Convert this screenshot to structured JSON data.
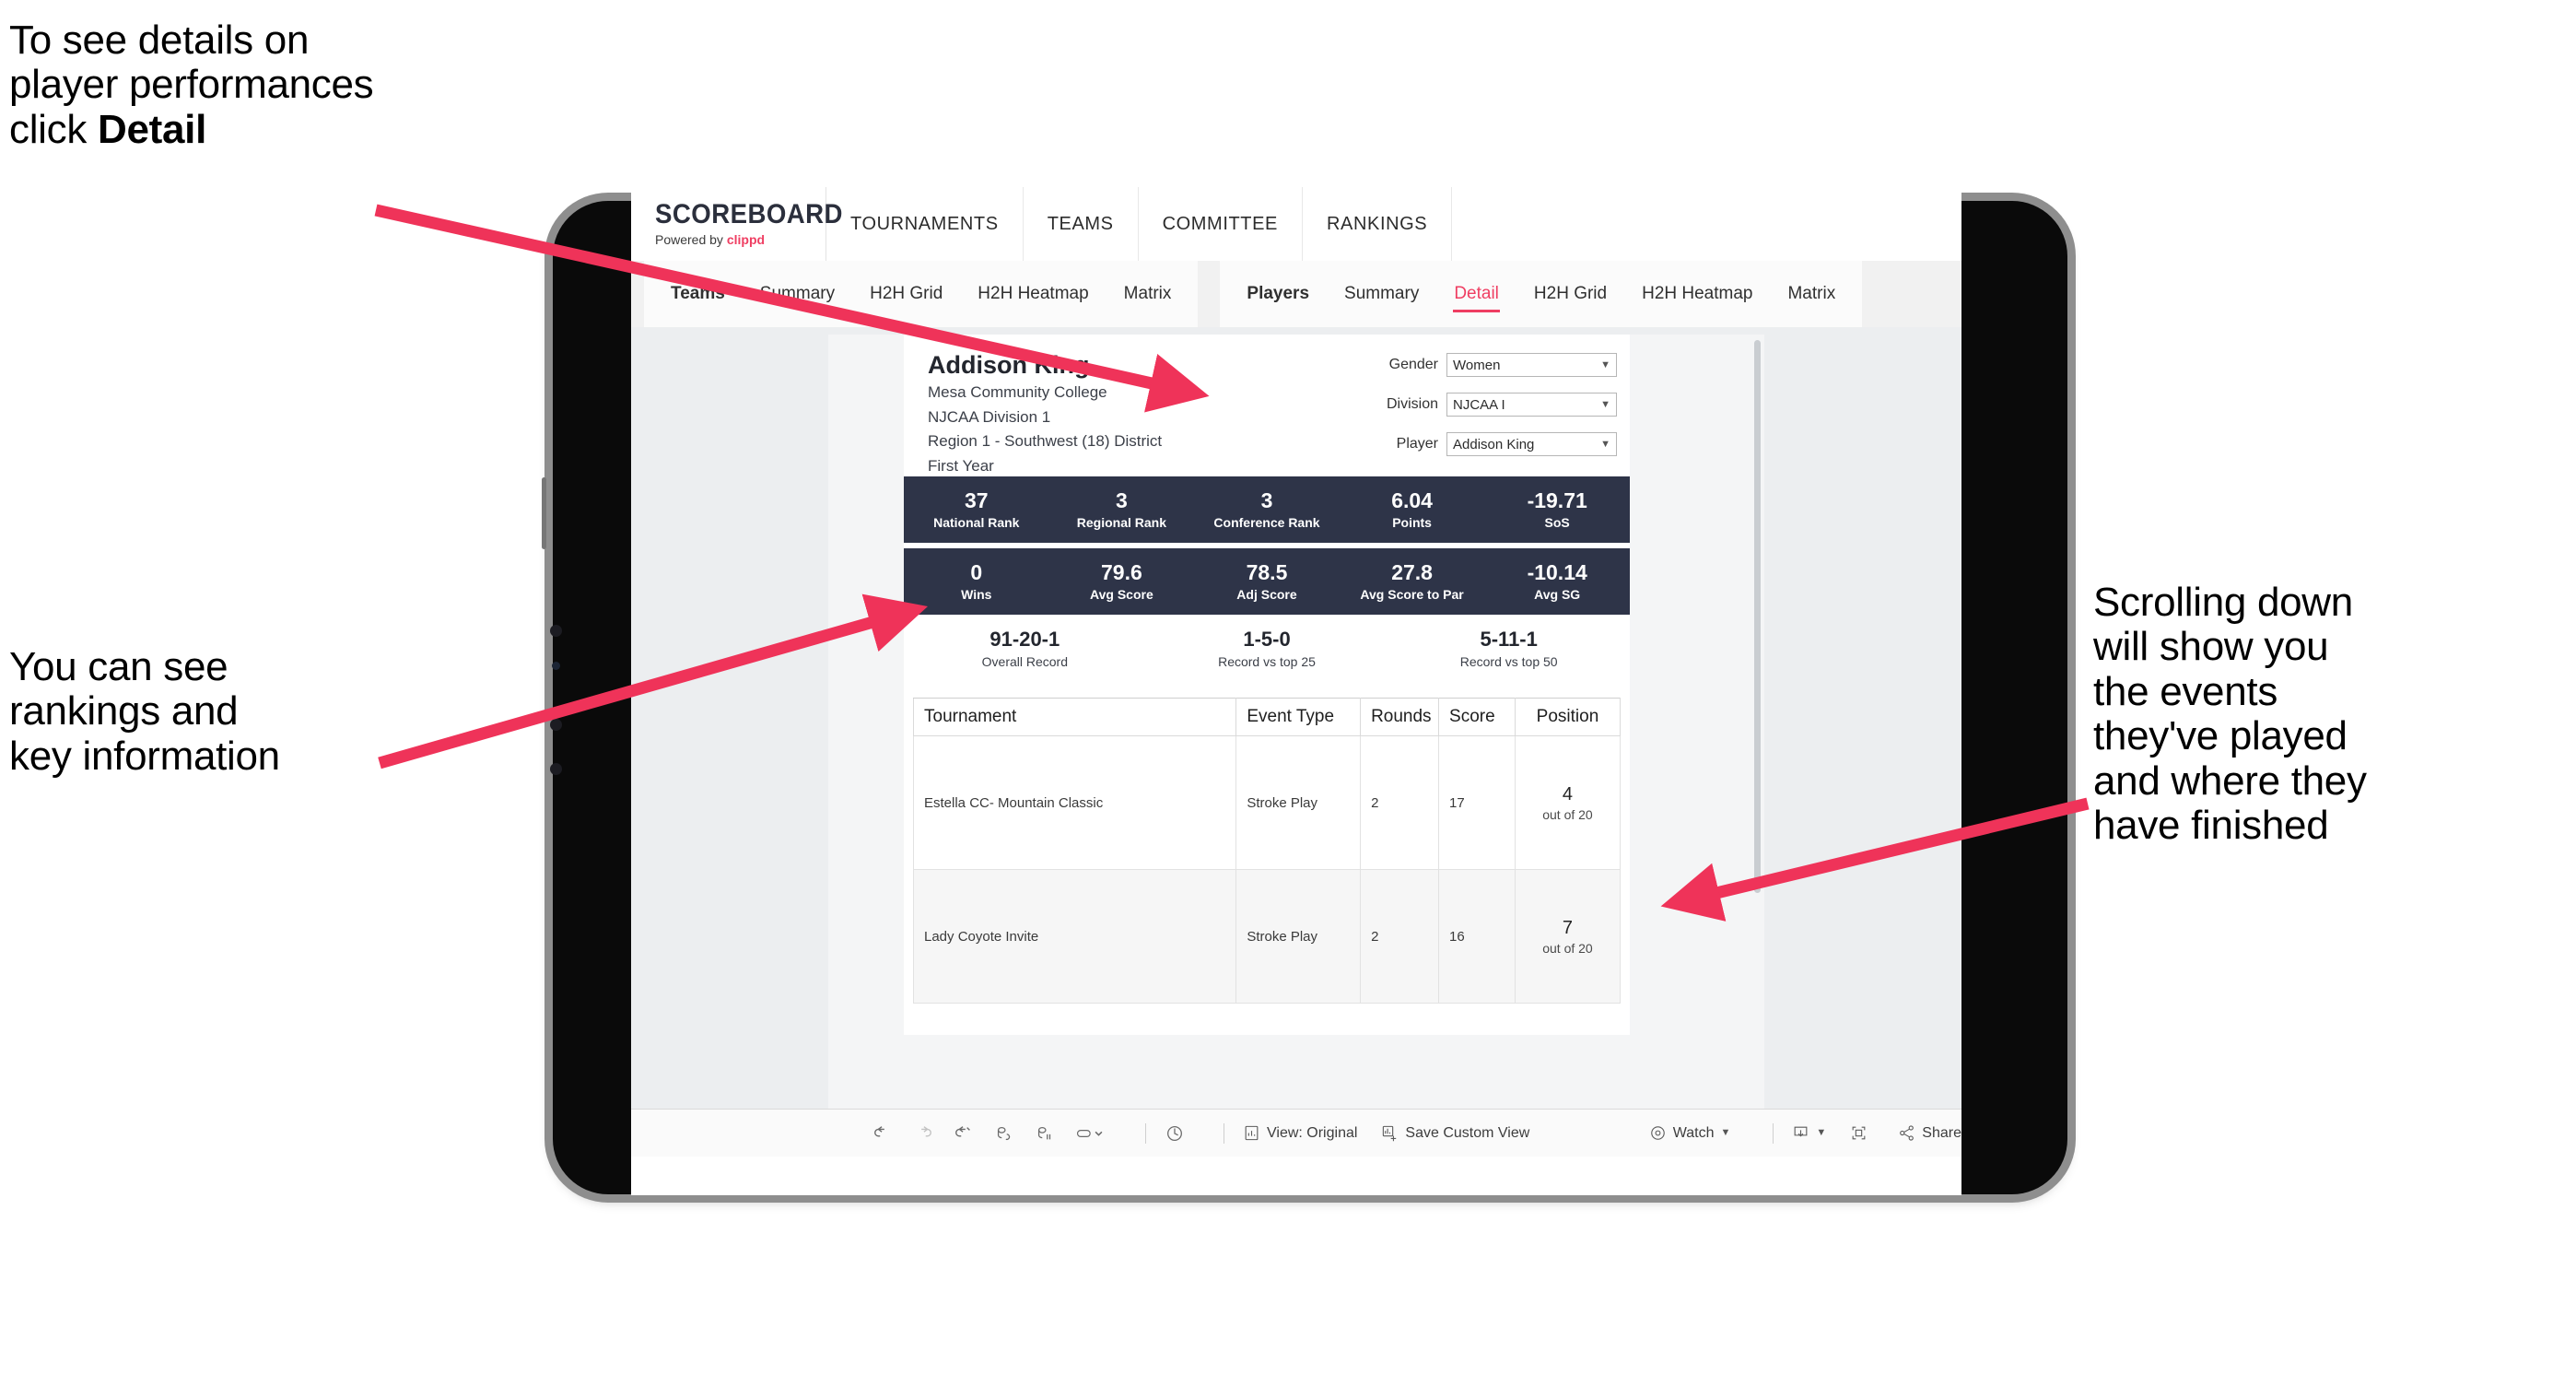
{
  "annotations": {
    "top_left": "To see details on\nplayer performances\nclick ",
    "top_left_bold": "Detail",
    "mid_left": "You can see\nrankings and\nkey information",
    "right": "Scrolling down\nwill show you\nthe events\nthey've played\nand where they\nhave finished"
  },
  "app": {
    "brand": {
      "name": "SCOREBOARD",
      "powered_prefix": "Powered by ",
      "powered_brand": "clippd"
    },
    "top_nav": [
      {
        "label": "TOURNAMENTS"
      },
      {
        "label": "TEAMS"
      },
      {
        "label": "COMMITTEE"
      },
      {
        "label": "RANKINGS"
      }
    ],
    "tab_group_teams": [
      {
        "label": "Teams",
        "lead": true
      },
      {
        "label": "Summary"
      },
      {
        "label": "H2H Grid"
      },
      {
        "label": "H2H Heatmap"
      },
      {
        "label": "Matrix"
      }
    ],
    "tab_group_players": [
      {
        "label": "Players",
        "lead": true
      },
      {
        "label": "Summary"
      },
      {
        "label": "Detail",
        "active": true
      },
      {
        "label": "H2H Grid"
      },
      {
        "label": "H2H Heatmap"
      },
      {
        "label": "Matrix"
      }
    ],
    "accent_color": "#ef3e62",
    "stat_bar_color": "#2e3448"
  },
  "player": {
    "name": "Addison King",
    "school": "Mesa Community College",
    "division": "NJCAA Division 1",
    "region": "Region 1 - Southwest (18) District",
    "class_year": "First Year"
  },
  "filters": [
    {
      "label": "Gender",
      "value": "Women"
    },
    {
      "label": "Division",
      "value": "NJCAA I"
    },
    {
      "label": "Player",
      "value": "Addison King"
    }
  ],
  "stats_row_1": [
    {
      "value": "37",
      "label": "National Rank"
    },
    {
      "value": "3",
      "label": "Regional Rank"
    },
    {
      "value": "3",
      "label": "Conference Rank"
    },
    {
      "value": "6.04",
      "label": "Points"
    },
    {
      "value": "-19.71",
      "label": "SoS"
    }
  ],
  "stats_row_2": [
    {
      "value": "0",
      "label": "Wins"
    },
    {
      "value": "79.6",
      "label": "Avg Score"
    },
    {
      "value": "78.5",
      "label": "Adj Score"
    },
    {
      "value": "27.8",
      "label": "Avg Score to Par"
    },
    {
      "value": "-10.14",
      "label": "Avg SG"
    }
  ],
  "records": [
    {
      "value": "91-20-1",
      "label": "Overall Record"
    },
    {
      "value": "1-5-0",
      "label": "Record vs top 25"
    },
    {
      "value": "5-11-1",
      "label": "Record vs top 50"
    }
  ],
  "events_table": {
    "columns": [
      "Tournament",
      "Event Type",
      "Rounds",
      "Score",
      "Position"
    ],
    "rows": [
      {
        "tournament": "Estella CC- Mountain Classic",
        "event_type": "Stroke Play",
        "rounds": "2",
        "score": "17",
        "position": "4",
        "position_sub": "out of 20"
      },
      {
        "tournament": "Lady Coyote Invite",
        "event_type": "Stroke Play",
        "rounds": "2",
        "score": "16",
        "position": "7",
        "position_sub": "out of 20"
      }
    ]
  },
  "toolbar": {
    "view_label": "View: Original",
    "save_label": "Save Custom View",
    "watch_label": "Watch",
    "share_label": "Share"
  }
}
